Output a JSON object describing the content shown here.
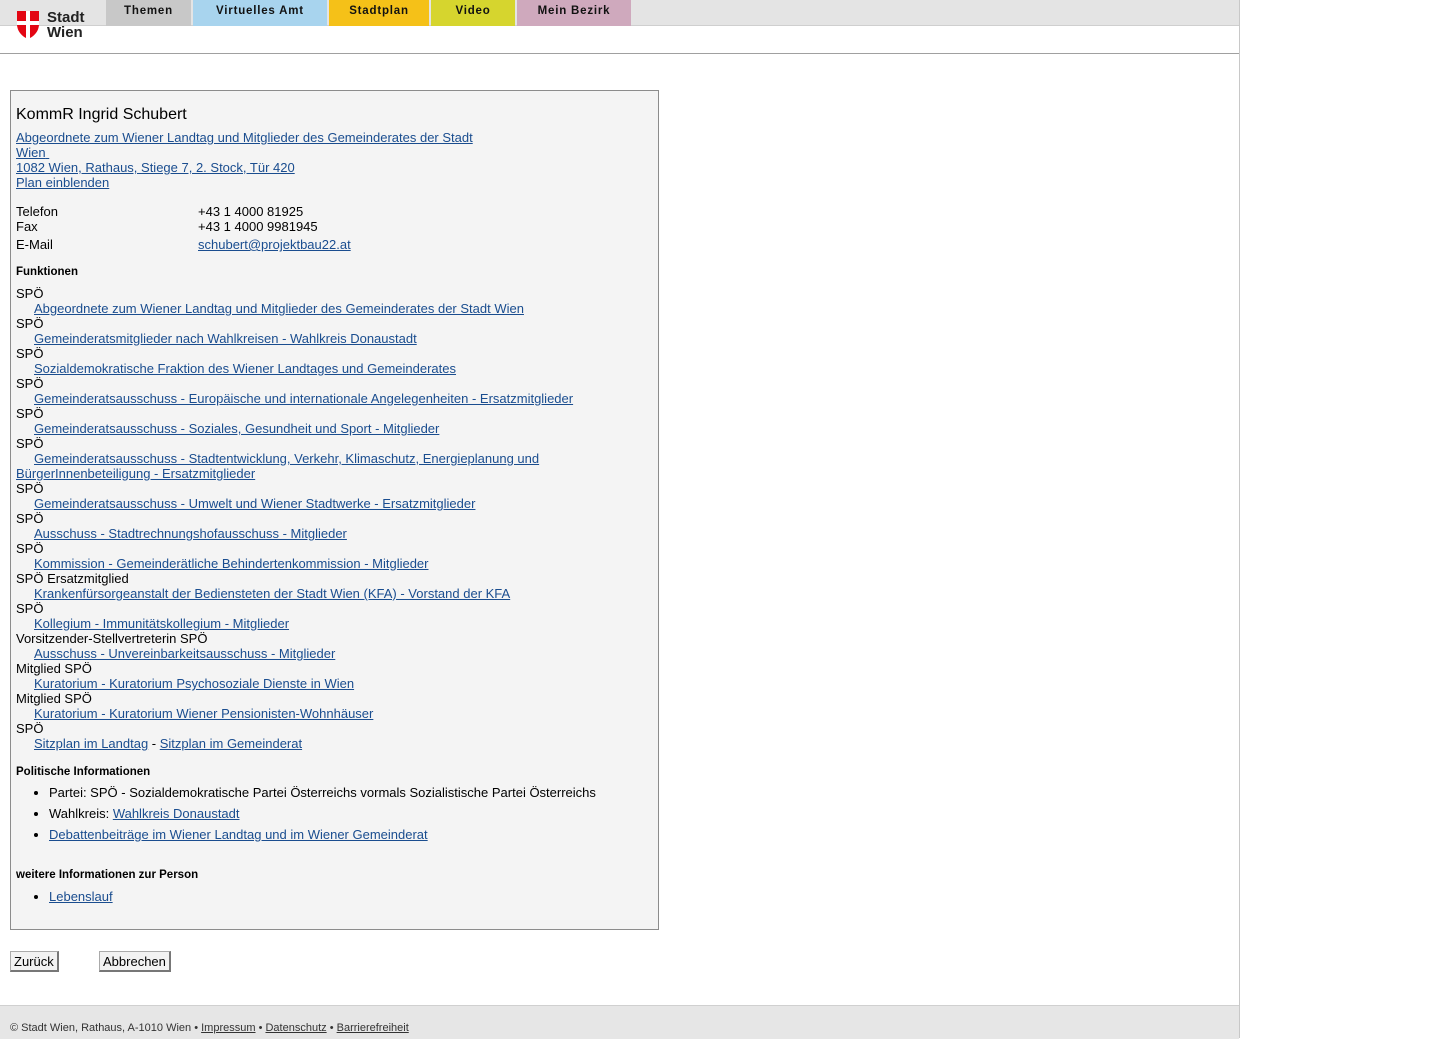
{
  "header": {
    "logo_line1": "Stadt",
    "logo_line2": "Wien",
    "nav": [
      {
        "label": "Themen",
        "color": "#c8c8c8"
      },
      {
        "label": "Virtuelles Amt",
        "color": "#a8d4ee"
      },
      {
        "label": "Stadtplan",
        "color": "#f5c118"
      },
      {
        "label": "Video",
        "color": "#d6d52e"
      },
      {
        "label": "Mein Bezirk",
        "color": "#cfa9bd"
      }
    ]
  },
  "person": {
    "name": "KommR Ingrid Schubert",
    "role_line1": "Abgeordnete zum Wiener Landtag und Mitglieder des Gemeinderates der Stadt",
    "role_line2": "Wien",
    "address": "1082 Wien, Rathaus, Stiege 7, 2. Stock, Tür 420",
    "plan_link": "Plan einblenden",
    "contact": {
      "phone_label": "Telefon",
      "phone": "+43 1 4000 81925",
      "fax_label": "Fax",
      "fax": "+43 1 4000 9981945",
      "email_label": "E-Mail",
      "email": "schubert@projektbau22.at"
    }
  },
  "functions": {
    "heading": "Funktionen",
    "items": [
      {
        "role": "SPÖ",
        "link": "Abgeordnete zum Wiener Landtag und Mitglieder des Gemeinderates der Stadt Wien"
      },
      {
        "role": "SPÖ",
        "link": "Gemeinderatsmitglieder nach Wahlkreisen - Wahlkreis Donaustadt"
      },
      {
        "role": "SPÖ",
        "link": "Sozialdemokratische Fraktion des Wiener Landtages und Gemeinderates"
      },
      {
        "role": "SPÖ",
        "link": "Gemeinderatsausschuss - Europäische und internationale Angelegenheiten - Ersatzmitglieder"
      },
      {
        "role": "SPÖ",
        "link": "Gemeinderatsausschuss - Soziales, Gesundheit und Sport - Mitglieder"
      },
      {
        "role": "SPÖ",
        "link": "Gemeinderatsausschuss - Stadtentwicklung, Verkehr, Klimaschutz, Energieplanung und",
        "link2": "BürgerInnenbeteiligung - Ersatzmitglieder"
      },
      {
        "role": "SPÖ",
        "link": "Gemeinderatsausschuss - Umwelt und Wiener Stadtwerke - Ersatzmitglieder"
      },
      {
        "role": "SPÖ",
        "link": "Ausschuss - Stadtrechnungshofausschuss - Mitglieder"
      },
      {
        "role": "SPÖ",
        "link": "Kommission - Gemeinderätliche Behindertenkommission - Mitglieder"
      },
      {
        "role": "SPÖ Ersatzmitglied",
        "link": "Krankenfürsorgeanstalt der Bediensteten der Stadt Wien (KFA) - Vorstand der KFA"
      },
      {
        "role": "SPÖ",
        "link": "Kollegium - Immunitätskollegium - Mitglieder"
      },
      {
        "role": "Vorsitzender-Stellvertreterin SPÖ",
        "link": "Ausschuss - Unvereinbarkeitsausschuss - Mitglieder"
      },
      {
        "role": "Mitglied SPÖ",
        "link": "Kuratorium - Kuratorium Psychosoziale Dienste in Wien"
      },
      {
        "role": "Mitglied SPÖ",
        "link": "Kuratorium - Kuratorium Wiener Pensionisten-Wohnhäuser"
      },
      {
        "role": "SPÖ"
      }
    ],
    "seat_landtag": "Sitzplan im Landtag",
    "seat_sep": " - ",
    "seat_gemeinderat": "Sitzplan im Gemeinderat"
  },
  "political": {
    "heading": "Politische Informationen",
    "party": "Partei: SPÖ - Sozialdemokratische Partei Österreichs vormals Sozialistische Partei Österreichs",
    "district_label": "Wahlkreis: ",
    "district_link": "Wahlkreis Donaustadt",
    "debates_link": "Debattenbeiträge im Wiener Landtag und im Wiener Gemeinderat"
  },
  "more": {
    "heading": "weitere Informationen zur Person",
    "cv_link": "Lebenslauf"
  },
  "buttons": {
    "back": "Zurück",
    "cancel": "Abbrechen"
  },
  "footer": {
    "copyright": "© Stadt Wien, Rathaus, A-1010 Wien • ",
    "impressum": "Impressum",
    "sep1": " • ",
    "datenschutz": "Datenschutz",
    "sep2": " • ",
    "barrierefreiheit": "Barrierefreiheit"
  }
}
